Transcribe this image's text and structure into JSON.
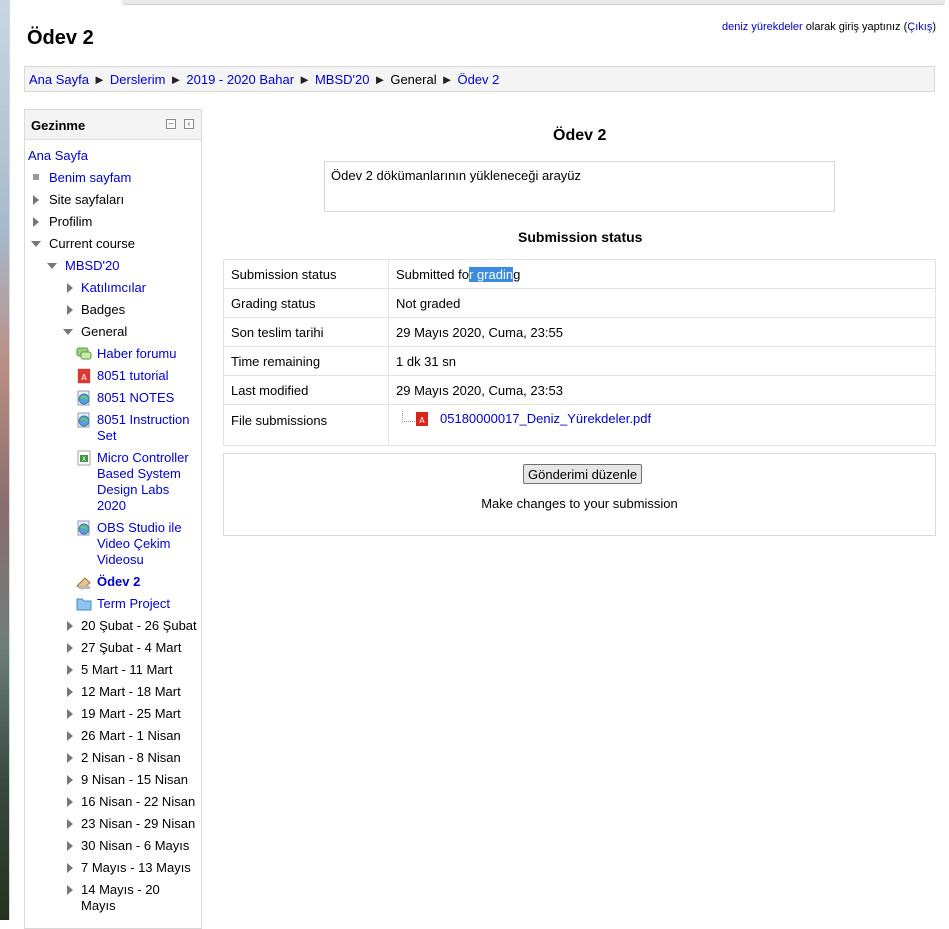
{
  "page": {
    "title": "Ödev 2",
    "login": {
      "user": "deniz yürekdeler",
      "text": "olarak giriş yaptınız",
      "open_paren": "(",
      "logout": "Çıkış",
      "close_paren": ")"
    }
  },
  "breadcrumb": {
    "separator": "►",
    "items": [
      "Ana Sayfa",
      "Derslerim",
      "2019 - 2020 Bahar",
      "MBSD'20",
      "General",
      "Ödev 2"
    ]
  },
  "nav": {
    "title": "Gezinme",
    "home": "Ana Sayfa",
    "my_page": "Benim sayfam",
    "site_pages": "Site sayfaları",
    "profile": "Profilim",
    "current_course": "Current course",
    "course": "MBSD'20",
    "participants": "Katılımcılar",
    "badges": "Badges",
    "general": "General",
    "activities": [
      {
        "label": "Haber forumu",
        "icon": "forum-icon"
      },
      {
        "label": "8051 tutorial",
        "icon": "pdf-icon"
      },
      {
        "label": "8051 NOTES",
        "icon": "url-icon"
      },
      {
        "label": "8051 Instruction Set",
        "icon": "url-icon"
      },
      {
        "label": "Micro Controller Based System Design Labs 2020",
        "icon": "spreadsheet-icon"
      },
      {
        "label": "OBS Studio ile Video Çekim Videosu",
        "icon": "url-icon"
      },
      {
        "label": "Ödev 2",
        "icon": "assignment-icon"
      },
      {
        "label": "Term Project",
        "icon": "folder-icon"
      }
    ],
    "weeks": [
      "20 Şubat - 26 Şubat",
      "27 Şubat - 4 Mart",
      "5 Mart - 11 Mart",
      "12 Mart - 18 Mart",
      "19 Mart - 25 Mart",
      "26 Mart - 1 Nisan",
      "2 Nisan - 8 Nisan",
      "9 Nisan - 15 Nisan",
      "16 Nisan - 22 Nisan",
      "23 Nisan - 29 Nisan",
      "30 Nisan - 6 Mayıs",
      "7 Mayıs - 13 Mayıs",
      "14 Mayıs - 20 Mayıs"
    ]
  },
  "main": {
    "title": "Ödev 2",
    "intro": "Ödev 2 dökümanlarının yükleneceği arayüz",
    "status_heading": "Submission status",
    "rows": [
      {
        "label": "Submission status",
        "value_pre": "Submitted fo",
        "value_hl": "r gradin",
        "value_post": "g"
      },
      {
        "label": "Grading status",
        "value": "Not graded"
      },
      {
        "label": "Son teslim tarihi",
        "value": "29 Mayıs 2020, Cuma, 23:55"
      },
      {
        "label": "Time remaining",
        "value": "1 dk 31 sn"
      },
      {
        "label": "Last modified",
        "value": "29 Mayıs 2020, Cuma, 23:53"
      },
      {
        "label": "File submissions",
        "file": "05180000017_Deniz_Yürekdeler.pdf"
      }
    ],
    "edit_button": "Gönderimi düzenle",
    "edit_desc": "Make changes to your submission"
  },
  "colors": {
    "link": "#0000cc",
    "selection": "#3b8be0",
    "block_header": "#f3f3f3"
  }
}
